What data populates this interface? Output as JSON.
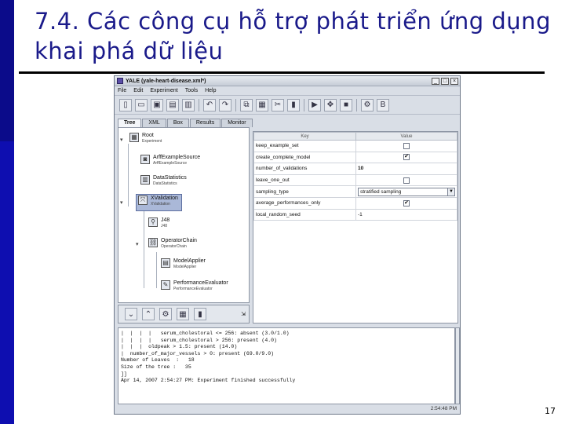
{
  "slide": {
    "title": "7.4. Các công cụ hỗ trợ phát triển ứng dụng khai phá dữ liệu",
    "page_number": "17"
  },
  "window": {
    "title": "YALE (yale-heart-disease.xml*)",
    "minimize": "_",
    "maximize": "□",
    "close": "×"
  },
  "menu": [
    "File",
    "Edit",
    "Experiment",
    "Tools",
    "Help"
  ],
  "tabs": [
    "Tree",
    "XML",
    "Box",
    "Results",
    "Monitor"
  ],
  "tree": [
    {
      "name": "Root",
      "class": "Experiment"
    },
    {
      "name": "ArffExampleSource",
      "class": "ArffExampleSource"
    },
    {
      "name": "DataStatistics",
      "class": "DataStatistics"
    },
    {
      "name": "XValidation",
      "class": "XValidation"
    },
    {
      "name": "J48",
      "class": "J48"
    },
    {
      "name": "OperatorChain",
      "class": "OperatorChain"
    },
    {
      "name": "ModelApplier",
      "class": "ModelApplier"
    },
    {
      "name": "PerformanceEvaluator",
      "class": "PerformanceEvaluator"
    }
  ],
  "params": {
    "header_key": "Key",
    "header_value": "Value",
    "rows": [
      {
        "key": "keep_example_set",
        "value": ""
      },
      {
        "key": "create_complete_model",
        "value": "✔"
      },
      {
        "key": "number_of_validations",
        "value": "10"
      },
      {
        "key": "leave_one_out",
        "value": ""
      },
      {
        "key": "sampling_type",
        "value": "stratified sampling"
      },
      {
        "key": "average_performances_only",
        "value": "✔"
      },
      {
        "key": "local_random_seed",
        "value": "-1"
      }
    ]
  },
  "log": [
    "|  |  |  |   serum_cholestoral <= 256: absent (3.0/1.0)",
    "|  |  |  |   serum_cholestoral > 256: present (4.0)",
    "|  |  |  oldpeak > 1.5: present (14.0)",
    "|  number_of_major_vessels > 0: present (69.0/9.0)",
    "Number of Leaves  :   18",
    "Size of the tree :   35",
    "]]",
    "Apr 14, 2007 2:54:27 PM: Experiment finished successfully"
  ],
  "status_time": "2:54:48 PM"
}
